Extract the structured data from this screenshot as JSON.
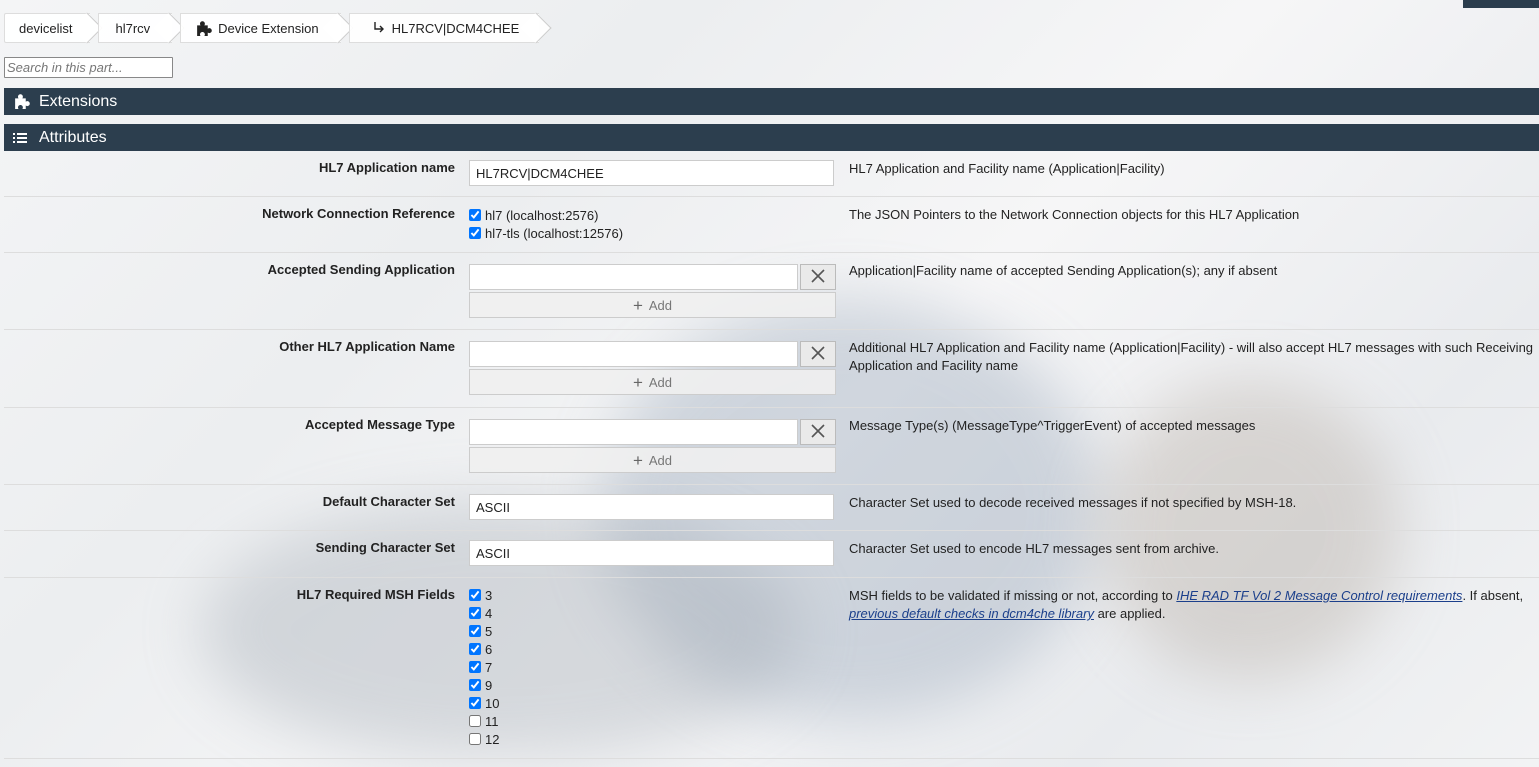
{
  "breadcrumb": [
    {
      "label": "devicelist",
      "icon": ""
    },
    {
      "label": "hl7rcv",
      "icon": ""
    },
    {
      "label": "Device Extension",
      "icon": "puzzle-icon"
    },
    {
      "label": "HL7RCV|DCM4CHEE",
      "icon": "arrow-return-icon"
    }
  ],
  "search": {
    "placeholder": "Search in this part..."
  },
  "sections": {
    "extensions": "Extensions",
    "attributes": "Attributes"
  },
  "fields": {
    "app_name": {
      "label": "HL7 Application name",
      "value": "HL7RCV|DCM4CHEE",
      "desc": "HL7 Application and Facility name (Application|Facility)"
    },
    "net_conn": {
      "label": "Network Connection Reference",
      "options": [
        "hl7 (localhost:2576)",
        "hl7-tls (localhost:12576)"
      ],
      "desc": "The JSON Pointers to the Network Connection objects for this HL7 Application"
    },
    "accepted_sending": {
      "label": "Accepted Sending Application",
      "value": "",
      "add_label": "Add",
      "desc": "Application|Facility name of accepted Sending Application(s); any if absent"
    },
    "other_name": {
      "label": "Other HL7 Application Name",
      "value": "",
      "add_label": "Add",
      "desc": "Additional HL7 Application and Facility name (Application|Facility) - will also accept HL7 messages with such Receiving Application and Facility name"
    },
    "accepted_msg": {
      "label": "Accepted Message Type",
      "value": "",
      "add_label": "Add",
      "desc": "Message Type(s) (MessageType^TriggerEvent) of accepted messages"
    },
    "default_charset": {
      "label": "Default Character Set",
      "value": "ASCII",
      "desc": "Character Set used to decode received messages if not specified by MSH-18."
    },
    "sending_charset": {
      "label": "Sending Character Set",
      "value": "ASCII",
      "desc": "Character Set used to encode HL7 messages sent from archive."
    },
    "msh_fields": {
      "label": "HL7 Required MSH Fields",
      "options": [
        {
          "label": "3",
          "checked": true
        },
        {
          "label": "4",
          "checked": true
        },
        {
          "label": "5",
          "checked": true
        },
        {
          "label": "6",
          "checked": true
        },
        {
          "label": "7",
          "checked": true
        },
        {
          "label": "9",
          "checked": true
        },
        {
          "label": "10",
          "checked": true
        },
        {
          "label": "11",
          "checked": false
        },
        {
          "label": "12",
          "checked": false
        }
      ],
      "desc_pre": "MSH fields to be validated if missing or not, according to ",
      "desc_link1": "IHE RAD TF Vol 2 Message Control requirements",
      "desc_mid": ". If absent, ",
      "desc_link2": "previous default checks in dcm4che library",
      "desc_post": " are applied."
    }
  }
}
